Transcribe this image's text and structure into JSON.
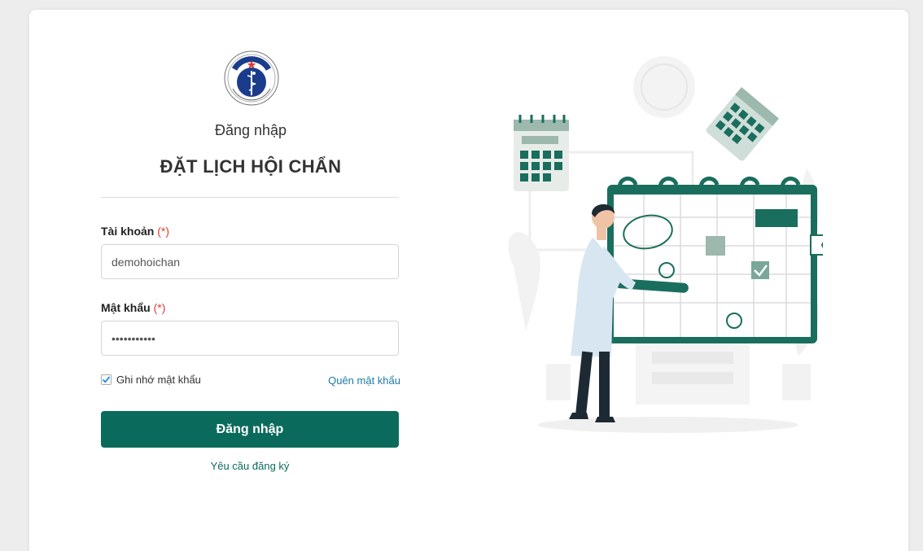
{
  "logo": {
    "text_top": "BỘ Y TẾ",
    "text_bottom": "MINISTRY OF HEALTH",
    "icon": "ministry-of-health-emblem"
  },
  "header": {
    "subtitle": "Đăng nhập",
    "title": "ĐẶT LỊCH HỘI CHẨN"
  },
  "form": {
    "username_label": "Tài khoản",
    "username_required": "(*)",
    "username_value": "demohoichan",
    "password_label": "Mật khẩu",
    "password_required": "(*)",
    "password_value": "demohoichan",
    "remember_label": "Ghi nhớ mật khẩu",
    "remember_checked": true,
    "forgot_label": "Quên mật khẩu",
    "submit_label": "Đăng nhập",
    "register_label": "Yêu cầu đăng ký"
  },
  "colors": {
    "primary": "#0a6b5c",
    "link": "#1e7aa8",
    "required": "#e53935"
  },
  "illustration": {
    "icon": "doctor-calendar-illustration"
  }
}
